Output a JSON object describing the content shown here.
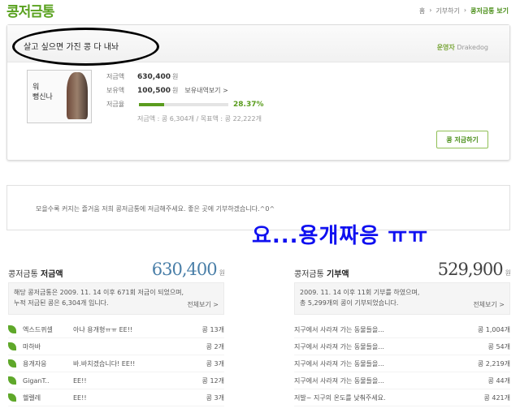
{
  "header": {
    "title": "콩저금통",
    "breadcrumb": [
      "홈",
      "›",
      "기부하기",
      "›",
      "콩저금통 보기"
    ]
  },
  "card": {
    "slogan": "살고 싶으면 가진 콩 다 내놔",
    "manager_label": "운영자",
    "manager_name": "Drakedog",
    "thumb_text": [
      "워",
      "뻥신나"
    ],
    "saved_label": "저금액",
    "saved_value": "630,400",
    "won": "원",
    "held_label": "보유액",
    "held_value": "100,500",
    "held_link": "보유내역보기 >",
    "rate_label": "저금율",
    "rate_value": "28.37%",
    "rate_fraction": 0.2837,
    "summary": "저금액 : 콩 6,304개  /  목표액 : 콩 22,222개",
    "donate_button": "콩 저금하기"
  },
  "notice": "모을수록 커지는 즐거움 저희 콩저금통에 저금해주세요. 좋은 곳에 기부하겠습니다.^0^",
  "overlay_text": "요...용개짜응 ㅠㅠ",
  "savings": {
    "heading_prefix": "콩저금통",
    "heading_bold": "저금액",
    "amount": "630,400",
    "unit": "원",
    "info_line1": "해당 콩저금통은 2009. 11. 14 이후 671회 저금이 되었으며,",
    "info_line2": "누적 저금된 콩은 6,304개 입니다.",
    "more": "전체보기 >",
    "items": [
      {
        "name": "엑스드퀴셀",
        "msg": "아냐 용개형ㅠㅠ EE!!",
        "amt": "콩 13개"
      },
      {
        "name": "마하바",
        "msg": "",
        "amt": "콩 2개"
      },
      {
        "name": "용개자응",
        "msg": "바.바치겠습니다! EE!!",
        "amt": "콩 3개"
      },
      {
        "name": "GiganT..",
        "msg": "EE!!",
        "amt": "콩 12개"
      },
      {
        "name": "헬렐레",
        "msg": "EE!!",
        "amt": "콩 3개"
      }
    ]
  },
  "donations": {
    "heading_prefix": "콩저금통",
    "heading_bold": "기부액",
    "amount": "529,900",
    "unit": "원",
    "info_line1": "2009. 11. 14 이후 11회 기부를 하였으며,",
    "info_line2": "총 5,299개의 콩이 기부되었습니다.",
    "more": "전체보기 >",
    "items": [
      {
        "msg": "지구에서 사라져 가는 동물들을...",
        "amt": "콩 1,004개"
      },
      {
        "msg": "지구에서 사라져 가는 동물들을...",
        "amt": "콩 54개"
      },
      {
        "msg": "지구에서 사라져 가는 동물들을...",
        "amt": "콩 2,219개"
      },
      {
        "msg": "지구에서 사라져 가는 동물들을...",
        "amt": "콩 44개"
      },
      {
        "msg": "저발~ 지구의 온도를 낮춰주세요.",
        "amt": "콩 421개"
      }
    ]
  }
}
